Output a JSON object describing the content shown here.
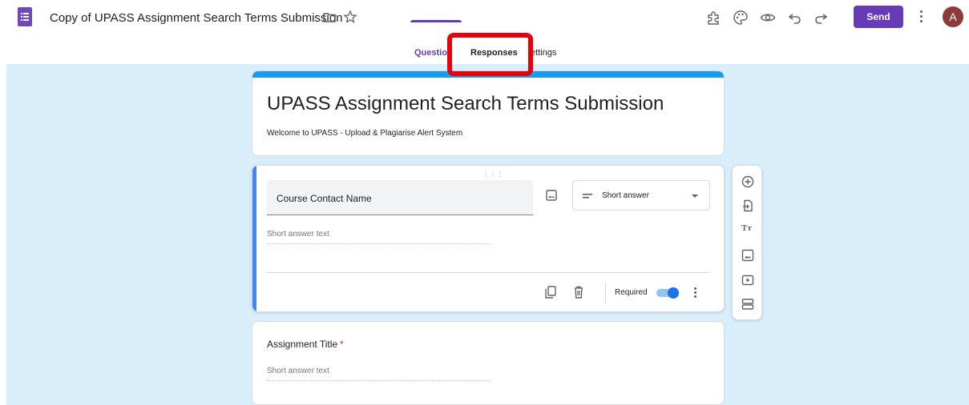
{
  "header": {
    "doc_title": "Copy of UPASS Assignment Search Terms Submission",
    "send_label": "Send",
    "avatar_initial": "A",
    "icons": [
      "addons-icon",
      "palette-icon",
      "preview-eye-icon",
      "undo-icon",
      "redo-icon",
      "more-vert-icon"
    ]
  },
  "tabs": [
    {
      "label": "Questio"
    },
    {
      "label": "Responses"
    },
    {
      "label": "ettings"
    }
  ],
  "form": {
    "title": "UPASS Assignment Search Terms Submission",
    "description": "Welcome to UPASS - Upload & Plagiarise Alert System"
  },
  "question1": {
    "title": "Course Contact Name",
    "type_label": "Short answer",
    "placeholder": "Short answer text",
    "required_label": "Required",
    "required": true
  },
  "question2": {
    "title": "Assignment Title",
    "required_mark": "*",
    "placeholder": "Short answer text"
  },
  "colors": {
    "accent": "#673ab7",
    "canvas": "#d9eefb",
    "highlight": "#e8000b",
    "header_bar": "#1a9bee"
  }
}
